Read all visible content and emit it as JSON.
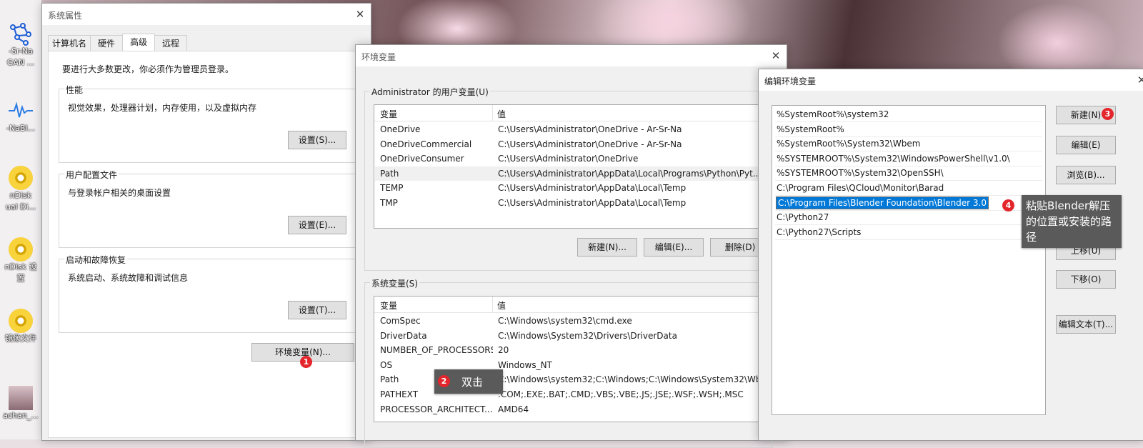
{
  "desktop": {
    "icons": [
      {
        "label": "-Sr-Na",
        "label2": "GAN ..."
      },
      {
        "label": "-NaBl..."
      },
      {
        "label": "nDisk",
        "label2": "ual Di..."
      },
      {
        "label": "nDisk 设",
        "label2": "置"
      },
      {
        "label": "镜像文件"
      },
      {
        "label": "achan_..."
      }
    ]
  },
  "sysprops": {
    "title": "系统属性",
    "tabs": [
      "计算机名",
      "硬件",
      "高级",
      "远程"
    ],
    "active_tab": "高级",
    "admin_note": "要进行大多数更改，你必须作为管理员登录。",
    "performance": {
      "title": "性能",
      "desc": "视觉效果，处理器计划，内存使用，以及虚拟内存",
      "button": "设置(S)..."
    },
    "profile": {
      "title": "用户配置文件",
      "desc": "与登录帐户相关的桌面设置",
      "button": "设置(E)..."
    },
    "startup": {
      "title": "启动和故障恢复",
      "desc": "系统启动、系统故障和调试信息",
      "button": "设置(T)..."
    },
    "env_button": "环境变量(N)..."
  },
  "envvars": {
    "title": "环境变量",
    "user_group": "Administrator 的用户变量(U)",
    "sys_group": "系统变量(S)",
    "col_var": "变量",
    "col_val": "值",
    "user_vars": [
      {
        "name": "OneDrive",
        "value": "C:\\Users\\Administrator\\OneDrive - Ar-Sr-Na"
      },
      {
        "name": "OneDriveCommercial",
        "value": "C:\\Users\\Administrator\\OneDrive - Ar-Sr-Na"
      },
      {
        "name": "OneDriveConsumer",
        "value": "C:\\Users\\Administrator\\OneDrive"
      },
      {
        "name": "Path",
        "value": "C:\\Users\\Administrator\\AppData\\Local\\Programs\\Python\\Pyt..."
      },
      {
        "name": "TEMP",
        "value": "C:\\Users\\Administrator\\AppData\\Local\\Temp"
      },
      {
        "name": "TMP",
        "value": "C:\\Users\\Administrator\\AppData\\Local\\Temp"
      }
    ],
    "sys_vars": [
      {
        "name": "ComSpec",
        "value": "C:\\Windows\\system32\\cmd.exe"
      },
      {
        "name": "DriverData",
        "value": "C:\\Windows\\System32\\Drivers\\DriverData"
      },
      {
        "name": "NUMBER_OF_PROCESSORS",
        "value": "20"
      },
      {
        "name": "OS",
        "value": "Windows_NT"
      },
      {
        "name": "Path",
        "value": "C:\\Windows\\system32;C:\\Windows;C:\\Windows\\System32\\Wb..."
      },
      {
        "name": "PATHEXT",
        "value": ".COM;.EXE;.BAT;.CMD;.VBS;.VBE;.JS;.JSE;.WSF;.WSH;.MSC"
      },
      {
        "name": "PROCESSOR_ARCHITECT...",
        "value": "AMD64"
      }
    ],
    "buttons": {
      "new": "新建(N)...",
      "edit": "编辑(E)...",
      "delete": "删除(D)"
    }
  },
  "editenv": {
    "title": "编辑环境变量",
    "entries": [
      "%SystemRoot%\\system32",
      "%SystemRoot%",
      "%SystemRoot%\\System32\\Wbem",
      "%SYSTEMROOT%\\System32\\WindowsPowerShell\\v1.0\\",
      "%SYSTEMROOT%\\System32\\OpenSSH\\",
      "C:\\Program Files\\QCloud\\Monitor\\Barad",
      "C:\\Program Files\\Blender Foundation\\Blender 3.0",
      "C:\\Python27",
      "C:\\Python27\\Scripts"
    ],
    "editing_index": 6,
    "buttons": {
      "new": "新建(N)",
      "edit": "编辑(E)",
      "browse": "浏览(B)...",
      "move_up": "上移(U)",
      "move_down": "下移(O)",
      "edit_text": "编辑文本(T)..."
    }
  },
  "annotations": {
    "badges": [
      "1",
      "2",
      "3",
      "4"
    ],
    "tip_double_click": "双击",
    "tip_paste": "粘贴Blender解压的位置或安装的路径"
  },
  "colors": {
    "badge": "#e3262c",
    "selection": "#0078d7",
    "tooltip": "#5a5a5a"
  }
}
